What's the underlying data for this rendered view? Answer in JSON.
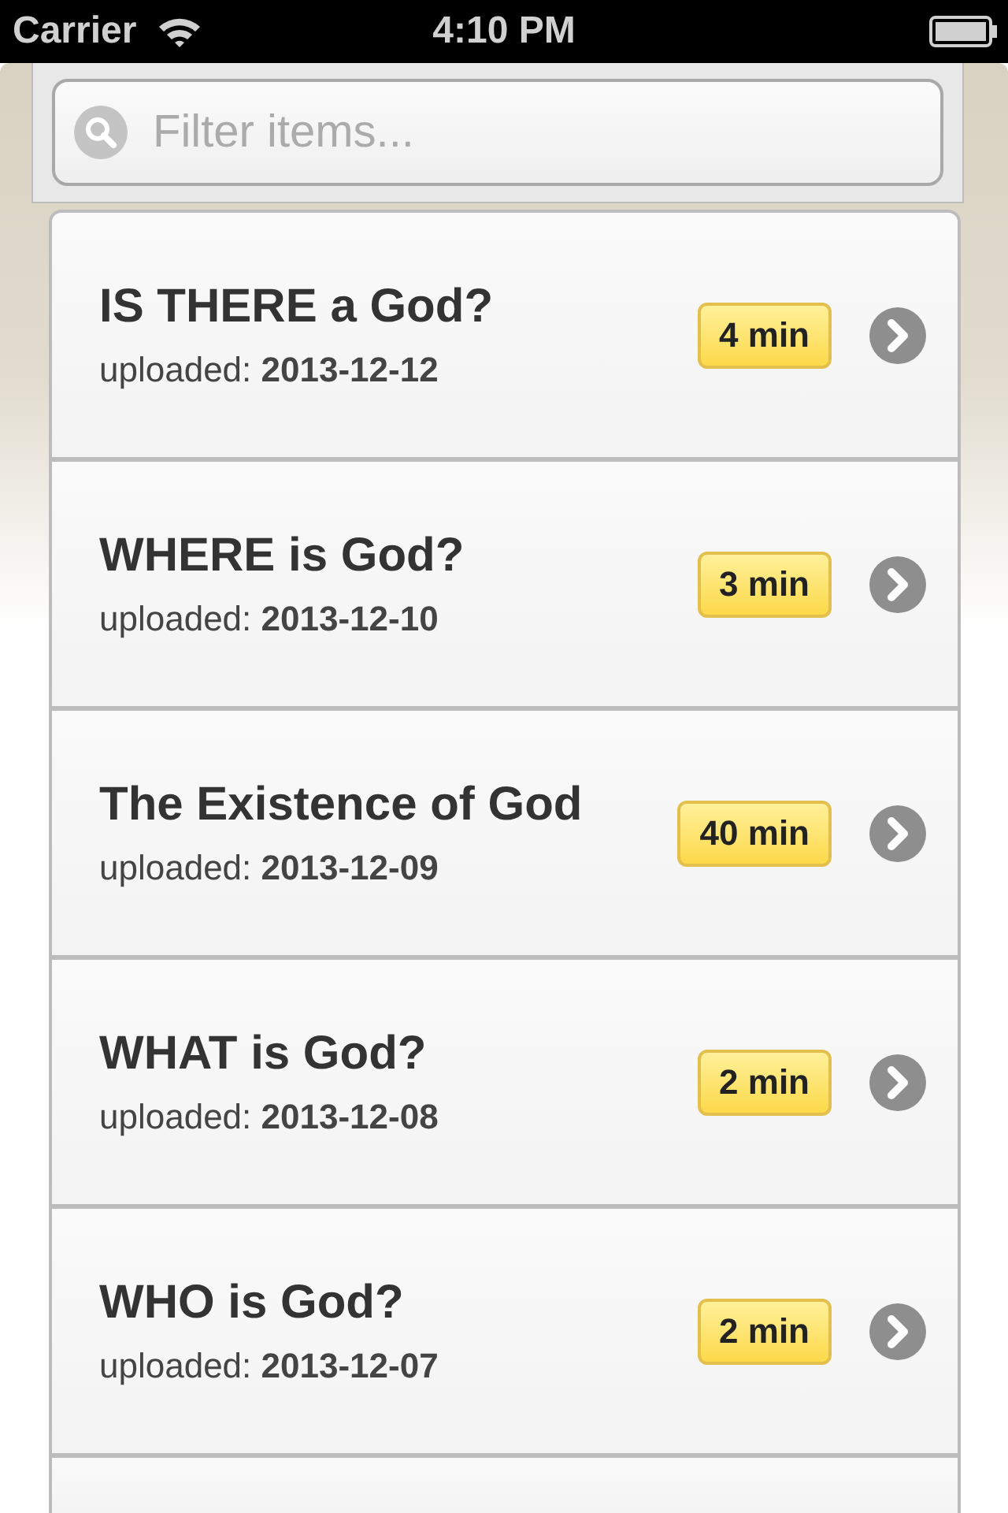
{
  "status_bar": {
    "carrier": "Carrier",
    "time": "4:10 PM"
  },
  "search": {
    "placeholder": "Filter items..."
  },
  "items": [
    {
      "title": "IS THERE a God?",
      "subtitle": "uploaded: **2013-12-12**",
      "duration": "4 min"
    },
    {
      "title": "WHERE is God?",
      "subtitle": "uploaded: **2013-12-10**",
      "duration": "3 min"
    },
    {
      "title": "The Existence of God",
      "subtitle": "uploaded: **2013-12-09**",
      "duration": "40 min"
    },
    {
      "title": "WHAT is God?",
      "subtitle": "uploaded: **2013-12-08**",
      "duration": "2 min"
    },
    {
      "title": "WHO is God?",
      "subtitle": "uploaded: **2013-12-07**",
      "duration": "2 min"
    }
  ]
}
